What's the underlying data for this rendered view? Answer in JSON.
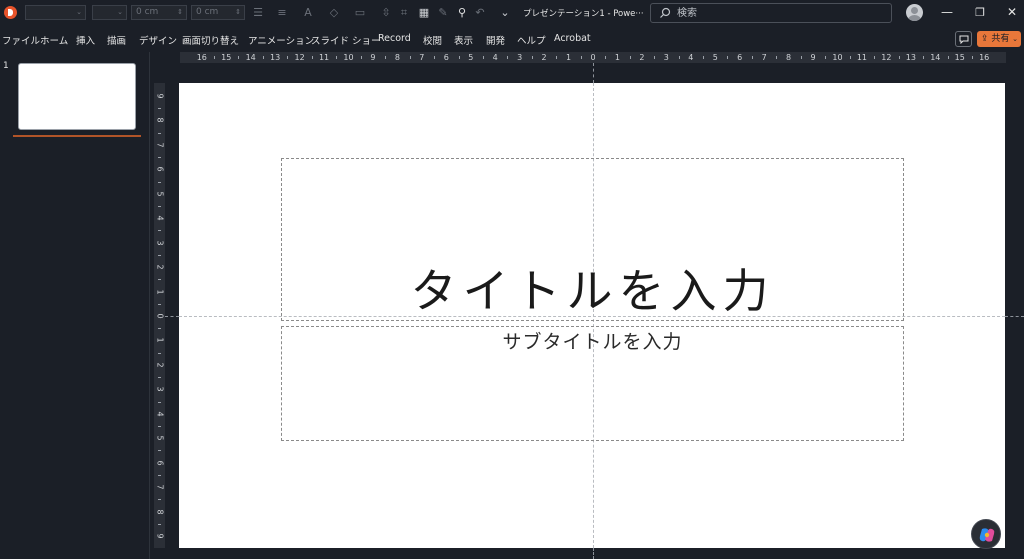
{
  "titlebar": {
    "app_icon": "powerpoint-icon",
    "quick_access": {
      "font_family_value": "",
      "font_size_value": "",
      "width_value": "0 cm",
      "height_value": "0 cm",
      "icons": [
        "align-icon",
        "line-spacing-icon",
        "font-color-icon",
        "highlight-icon",
        "outline-icon",
        "size-icon",
        "crop-icon",
        "image-icon",
        "clip-icon",
        "search-zoom-icon",
        "undo-icon",
        "customize-icon"
      ]
    },
    "document_title": "プレゼンテーション1  -  Powe···",
    "search_placeholder": "検索",
    "window_controls": {
      "minimize": "—",
      "restore": "❐",
      "close": "✕"
    }
  },
  "menu": {
    "items": [
      "ファイル",
      "ホーム",
      "挿入",
      "描画",
      "デザイン",
      "画面切り替え",
      "アニメーション",
      "スライド ショー",
      "Record",
      "校閲",
      "表示",
      "開発",
      "ヘルプ",
      "Acrobat"
    ],
    "share_label": "共有",
    "comment_icon": "comment-icon"
  },
  "thumbnails": {
    "items": [
      {
        "number": "1"
      }
    ]
  },
  "rulers": {
    "horizontal": [
      "16",
      "15",
      "14",
      "13",
      "12",
      "11",
      "10",
      "9",
      "8",
      "7",
      "6",
      "5",
      "4",
      "3",
      "2",
      "1",
      "0",
      "1",
      "2",
      "3",
      "4",
      "5",
      "6",
      "7",
      "8",
      "9",
      "10",
      "11",
      "12",
      "13",
      "14",
      "15",
      "16"
    ],
    "vertical": [
      "9",
      "8",
      "7",
      "6",
      "5",
      "4",
      "3",
      "2",
      "1",
      "0",
      "1",
      "2",
      "3",
      "4",
      "5",
      "6",
      "7",
      "8",
      "9"
    ]
  },
  "slide": {
    "title_placeholder": "タイトルを入力",
    "subtitle_placeholder": "サブタイトルを入力"
  },
  "colors": {
    "background": "#1b1f27",
    "accent_share": "#e8773a",
    "thumb_selected_line": "#b15428",
    "slide": "#ffffff"
  }
}
